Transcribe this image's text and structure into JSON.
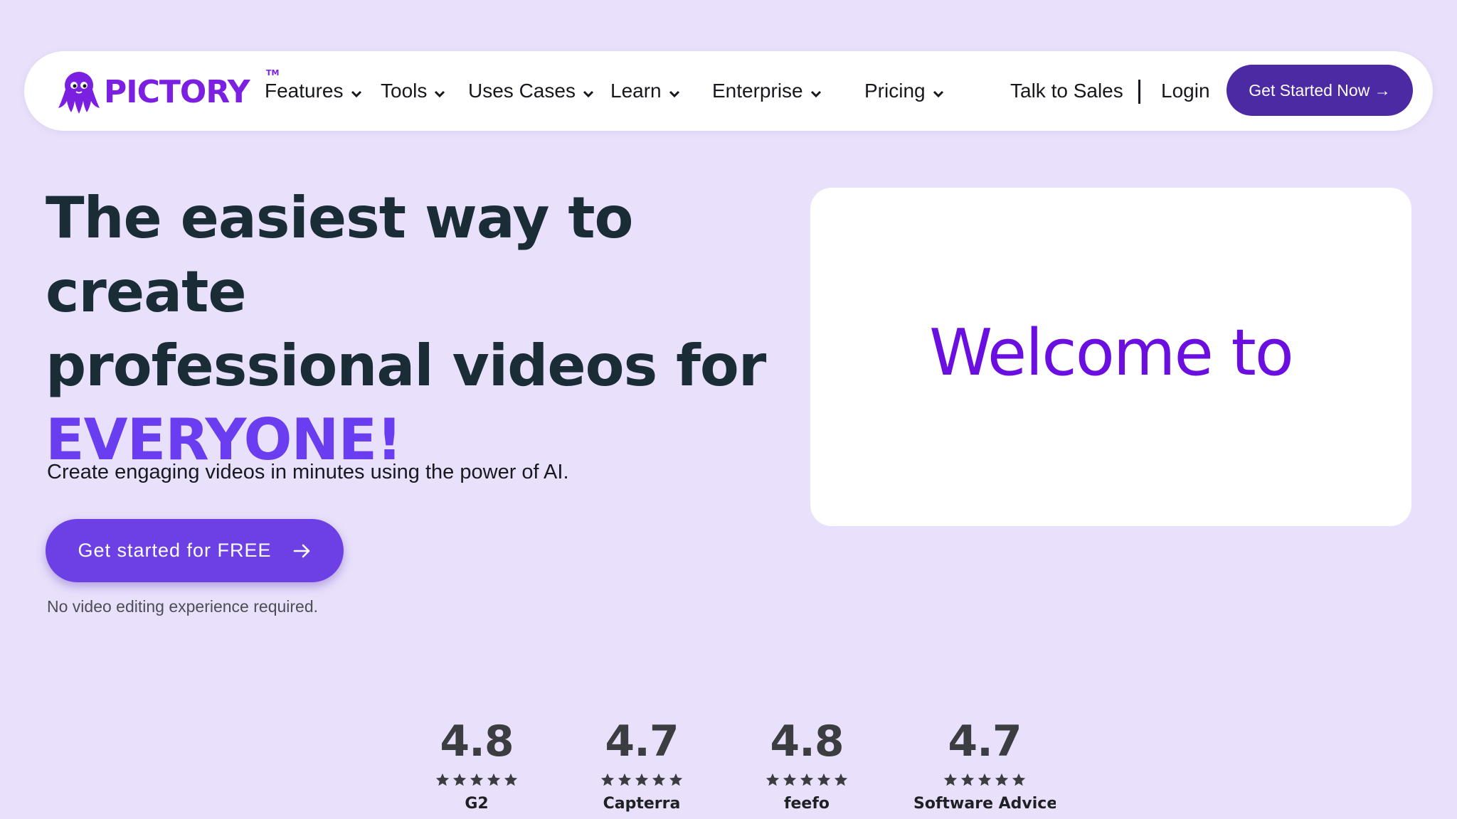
{
  "nav": {
    "logo_text": "PICTORY",
    "logo_tm": "TM",
    "items": [
      {
        "label": "Features"
      },
      {
        "label": "Tools"
      },
      {
        "label": "Uses Cases"
      },
      {
        "label": "Learn"
      },
      {
        "label": "Enterprise"
      },
      {
        "label": "Pricing"
      }
    ],
    "talk_to_sales": "Talk to Sales",
    "login": "Login",
    "cta": "Get Started Now →"
  },
  "hero": {
    "headline_line1": "The easiest way to create",
    "headline_line2": "professional videos for",
    "headline_accent": "EVERYONE!",
    "subtext": "Create engaging videos in minutes using the power of AI.",
    "cta": "Get started for FREE",
    "note": "No video editing experience required."
  },
  "video": {
    "text": "Welcome to"
  },
  "ratings": [
    {
      "score": "4.8",
      "stars": 5,
      "source": "G2"
    },
    {
      "score": "4.7",
      "stars": 5,
      "source": "Capterra"
    },
    {
      "score": "4.8",
      "stars": 5,
      "source": "feefo"
    },
    {
      "score": "4.7",
      "stars": 5,
      "source": "Software Advice"
    }
  ],
  "colors": {
    "background": "#e9e1fb",
    "brand_purple": "#7b1fe0",
    "nav_cta": "#4b2aa3",
    "hero_cta": "#6d40e6",
    "accent_text": "#6a3df0"
  }
}
